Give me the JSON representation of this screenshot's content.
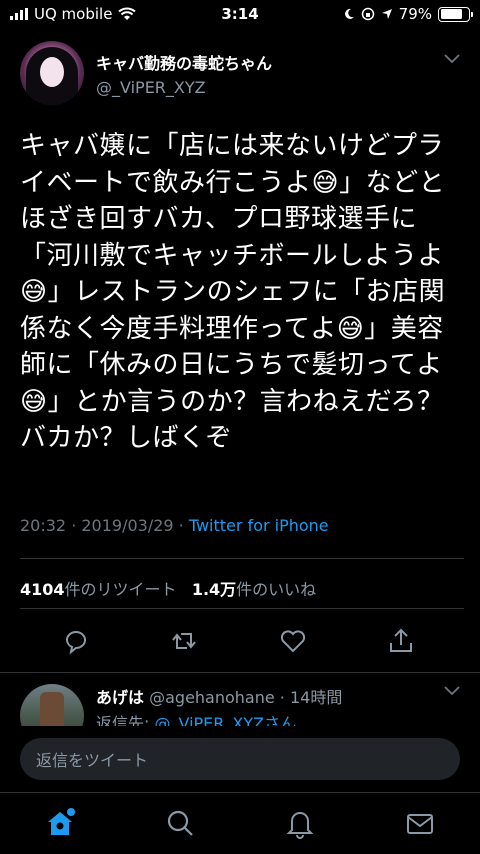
{
  "status_bar": {
    "carrier": "UQ mobile",
    "time": "3:14",
    "battery": "79%",
    "battery_level": 0.79
  },
  "tweet": {
    "display_name": "キャバ勤務の毒蛇ちゃん",
    "handle": "@_ViPER_XYZ",
    "text": "キャバ嬢に「店には来ないけどプライベートで飲み行こうよ😅」などとほざき回すバカ、プロ野球選手に「河川敷でキャッチボールしようよ😅」レストランのシェフに「お店関係なく今度手料理作ってよ😅」美容師に「休みの日にうちで髪切ってよ😅」とか言うのか？言わねえだろ？バカか？しばくぞ",
    "timestamp": "20:32 · 2019/03/29 · ",
    "source": "Twitter for iPhone",
    "retweet_count": "4104",
    "retweet_label": "件のリツイート",
    "like_count": "1.4万",
    "like_label": "件のいいね"
  },
  "reply": {
    "name": "あげは",
    "handle_time": "@agehanohane · 14時間",
    "reply_to_prefix": "返信先: ",
    "reply_to": "@_ViPER_XYZさん"
  },
  "compose": {
    "placeholder": "返信をツイート"
  },
  "icons": {
    "wifi": "wifi-icon",
    "moon": "moon-icon",
    "lock": "orientation-lock-icon",
    "location": "location-icon",
    "reply": "reply-icon",
    "retweet": "retweet-icon",
    "like": "heart-icon",
    "share": "share-icon",
    "home": "home-icon",
    "search": "search-icon",
    "notifications": "bell-icon",
    "messages": "mail-icon"
  },
  "colors": {
    "background": "#000000",
    "accent": "#1d9bf0",
    "secondary_text": "#8b98a5"
  }
}
